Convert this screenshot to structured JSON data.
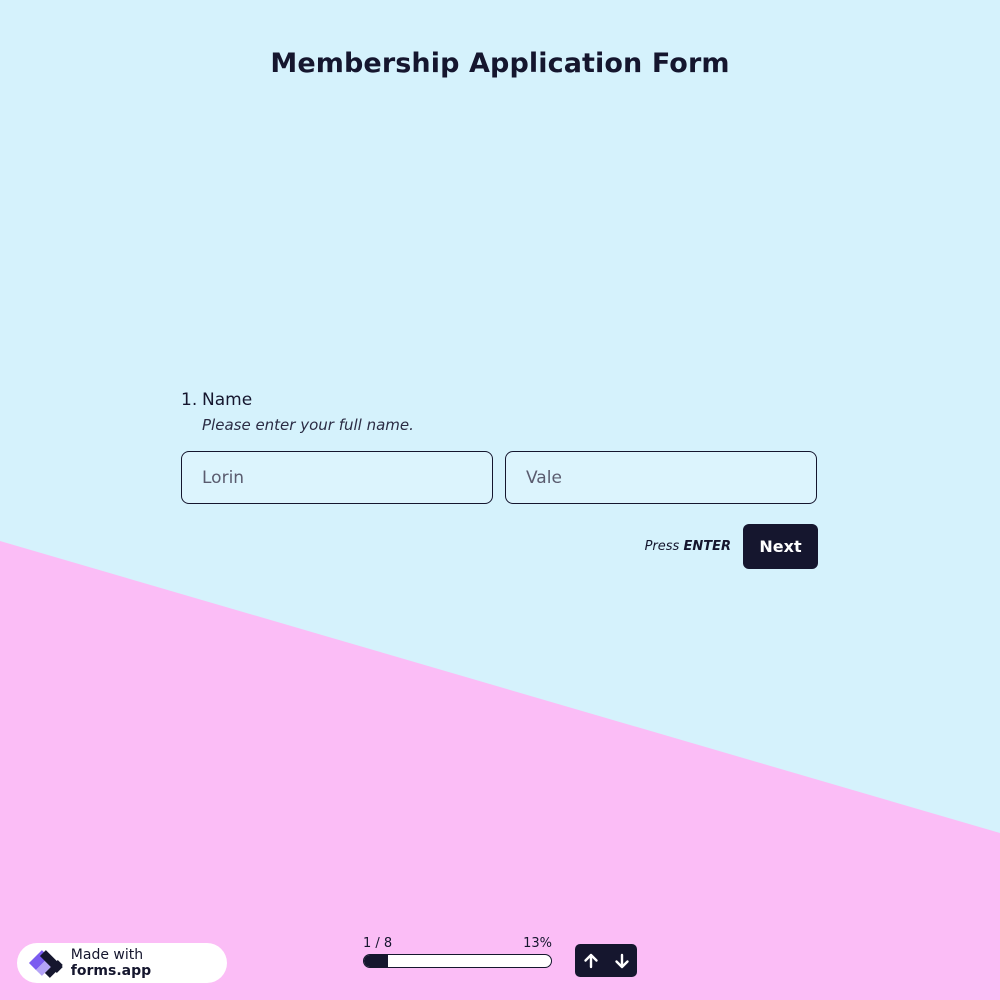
{
  "form": {
    "title": "Membership Application Form"
  },
  "question": {
    "number": "1.",
    "label": "Name",
    "description": "Please enter your full name.",
    "first_name_value": "Lorin",
    "last_name_value": "Vale"
  },
  "actions": {
    "press_hint_prefix": "Press ",
    "press_hint_key": "ENTER",
    "next_label": "Next"
  },
  "progress": {
    "step_text": "1 / 8",
    "percent_text": "13%",
    "fraction": 0.13
  },
  "badge": {
    "prefix": "Made with ",
    "brand": "forms.app"
  },
  "navigation": {
    "up_icon": "arrow-up-icon",
    "down_icon": "arrow-down-icon"
  },
  "colors": {
    "background_blue": "#d5f2fc",
    "background_pink": "#fbbdf6",
    "primary_dark": "#15162e",
    "logo_purple": "#7b5cf0"
  }
}
